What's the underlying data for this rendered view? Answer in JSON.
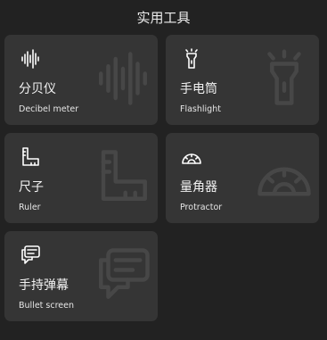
{
  "header": {
    "title": "实用工具"
  },
  "tools": [
    {
      "name": "分贝仪",
      "subtitle": "Decibel meter",
      "icon": "soundwave-icon"
    },
    {
      "name": "手电筒",
      "subtitle": "Flashlight",
      "icon": "flashlight-icon"
    },
    {
      "name": "尺子",
      "subtitle": "Ruler",
      "icon": "ruler-icon"
    },
    {
      "name": "量角器",
      "subtitle": "Protractor",
      "icon": "protractor-icon"
    },
    {
      "name": "手持弹幕",
      "subtitle": "Bullet screen",
      "icon": "chat-bubble-icon"
    }
  ],
  "colors": {
    "background": "#222222",
    "card": "#353535",
    "text": "#f2f2f2"
  }
}
